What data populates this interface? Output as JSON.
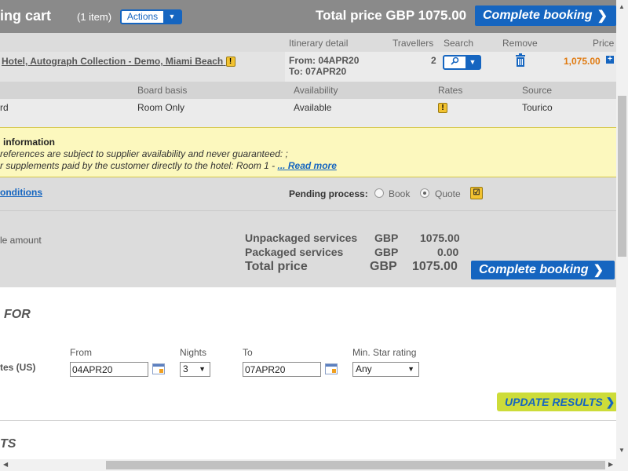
{
  "header": {
    "title": "ing cart",
    "item_count": "(1 item)",
    "actions_label": "Actions",
    "total_label": "Total price GBP 1075.00",
    "complete_label": "Complete booking"
  },
  "itinerary": {
    "col_itinerary": "Itinerary detail",
    "col_travellers": "Travellers",
    "col_search": "Search",
    "col_remove": "Remove",
    "col_price": "Price",
    "hotel_name": "Hotel, Autograph Collection - Demo, Miami Beach",
    "from": "From: 04APR20",
    "to": "To: 07APR20",
    "travellers": "2",
    "price": "1,075.00"
  },
  "room": {
    "col_board": "Board basis",
    "col_availability": "Availability",
    "col_rates": "Rates",
    "col_source": "Source",
    "room_type": "rd",
    "board": "Room Only",
    "availability": "Available",
    "source": "Tourico"
  },
  "info": {
    "title": "information",
    "line1": "references are subject to supplier availability and never guaranteed: ;",
    "line2": "r supplements paid by the customer directly to the hotel: Room 1 - ",
    "read_more": "... Read more"
  },
  "conditions_link": "onditions",
  "pending": {
    "label": "Pending process:",
    "options": [
      "Book",
      "Quote"
    ],
    "selected": "Quote"
  },
  "summary": {
    "left_label": "le amount",
    "rows": [
      {
        "label": "Unpackaged services",
        "currency": "GBP",
        "value": "1075.00"
      },
      {
        "label": "Packaged services",
        "currency": "GBP",
        "value": "0.00"
      },
      {
        "label": "Total price",
        "currency": "GBP",
        "value": "1075.00"
      }
    ],
    "complete_label": "Complete booking"
  },
  "search_form": {
    "section_title": "FOR",
    "location_label": "tes (US)",
    "from_label": "From",
    "from_value": "04APR20",
    "nights_label": "Nights",
    "nights_value": "3",
    "to_label": "To",
    "to_value": "07APR20",
    "star_label": "Min. Star rating",
    "star_value": "Any",
    "update_label": "UPDATE RESULTS"
  },
  "results_title": "TS",
  "colors": {
    "header_bg": "#8a8a8a",
    "primary": "#1565c0",
    "price_orange": "#e07a10",
    "info_bg": "#fcf8be",
    "update_bg": "#cddc39"
  },
  "icons": [
    "caret-down-icon",
    "search-icon",
    "trash-icon",
    "plus-icon",
    "warning-icon",
    "calendar-icon",
    "checklist-icon",
    "chevron-right-icon"
  ]
}
